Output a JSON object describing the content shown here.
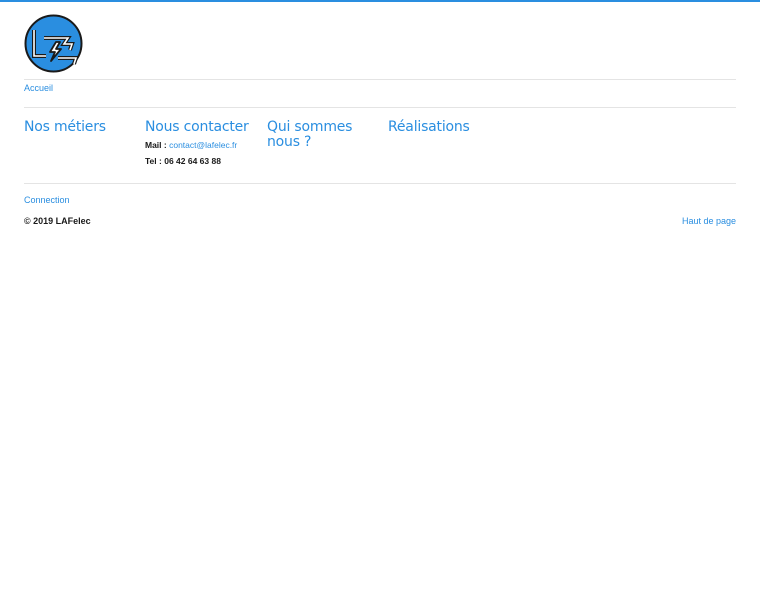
{
  "header": {
    "logo_icon": "lafelec-lightning-logo-icon"
  },
  "breadcrumb": {
    "home_label": "Accueil"
  },
  "sections": [
    {
      "title": "Nos métiers"
    },
    {
      "title": "Nous contacter",
      "mail_label": "Mail : ",
      "mail_value": "contact@lafelec.fr",
      "tel_label": "Tel : ",
      "tel_value": "06 42 64 63 88"
    },
    {
      "title": "Qui sommes nous ?"
    },
    {
      "title": "Réalisations"
    }
  ],
  "footer": {
    "connection_label": "Connection",
    "copyright": "© 2019 LAFelec",
    "back_to_top_label": "Haut de page"
  },
  "colors": {
    "accent": "#2a8ee0",
    "text": "#1a1a1a",
    "divider": "#e4e4e4"
  }
}
